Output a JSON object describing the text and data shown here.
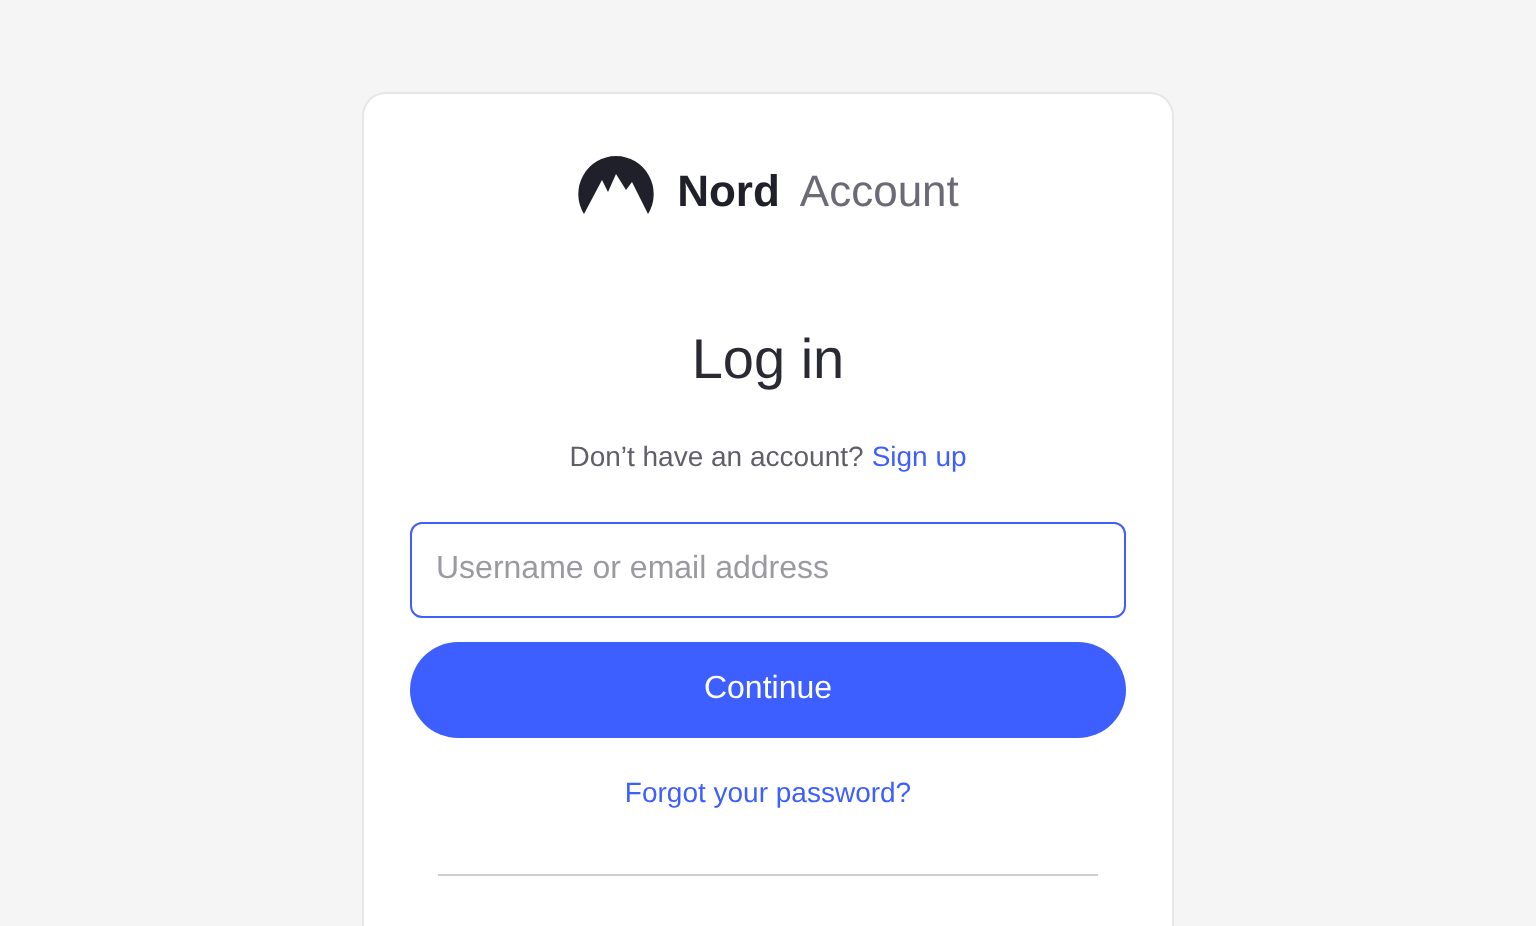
{
  "logo": {
    "brand": "Nord",
    "product": "Account"
  },
  "heading": "Log in",
  "signup_prompt": {
    "text": "Don’t have an account?",
    "link": "Sign up"
  },
  "username_field": {
    "placeholder": "Username or email address"
  },
  "continue_button": "Continue",
  "forgot_link": "Forgot your password?"
}
